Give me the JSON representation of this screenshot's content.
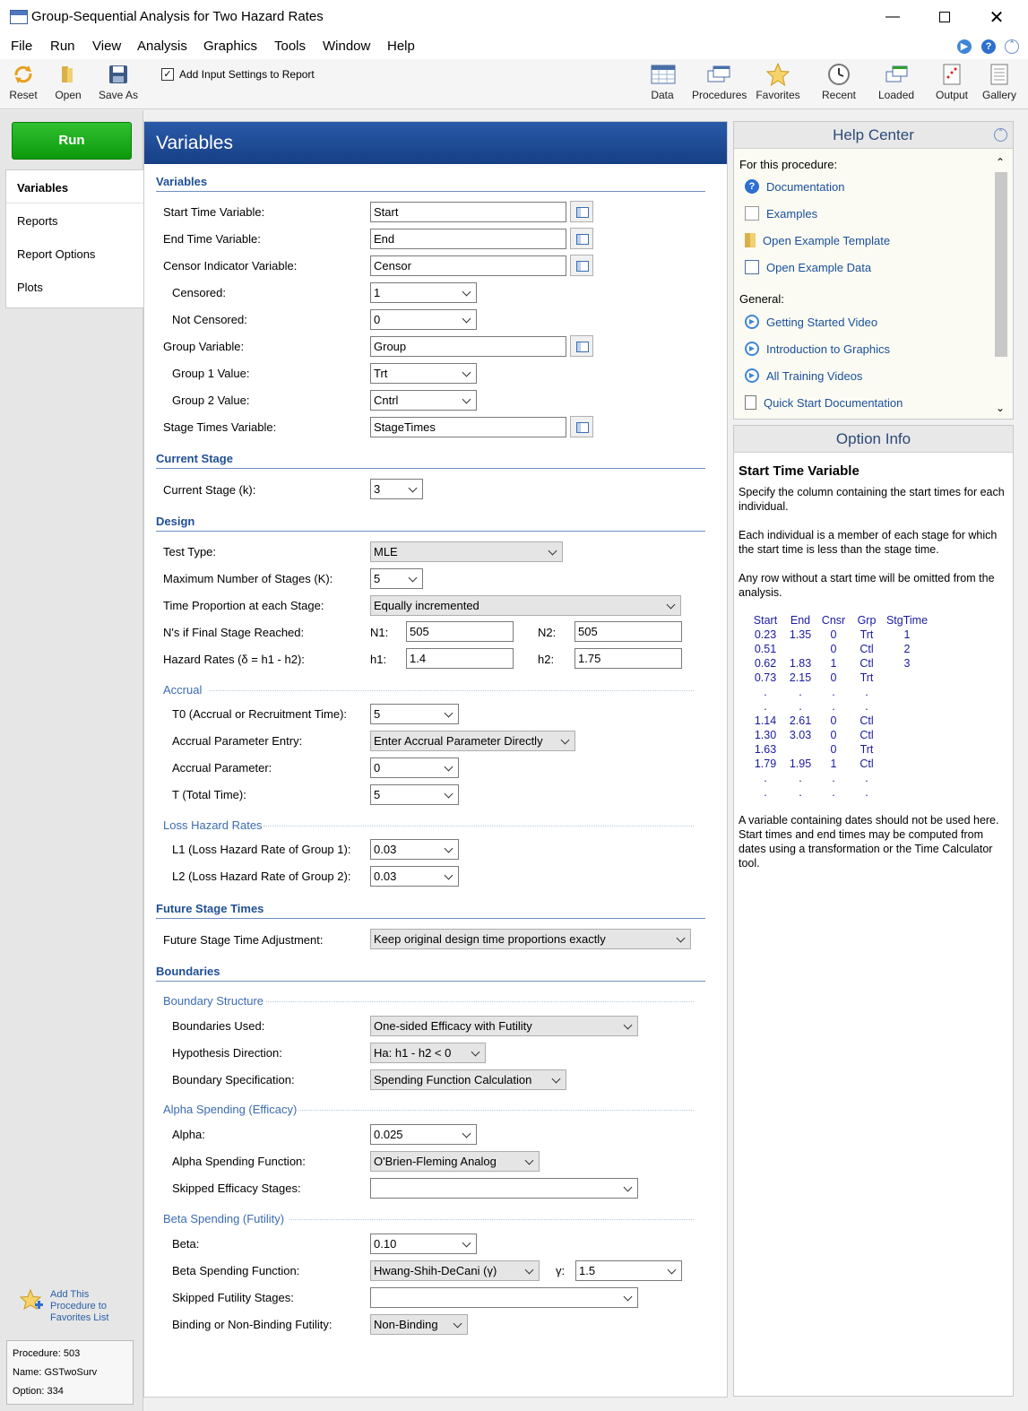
{
  "window": {
    "title": "Group-Sequential Analysis for Two Hazard Rates"
  },
  "menu": [
    "File",
    "Run",
    "View",
    "Analysis",
    "Graphics",
    "Tools",
    "Window",
    "Help"
  ],
  "toolbar": {
    "reset": "Reset",
    "open": "Open",
    "save_as": "Save As",
    "add_input": "Add Input Settings to Report",
    "data": "Data",
    "procedures": "Procedures",
    "favorites": "Favorites",
    "recent": "Recent",
    "loaded": "Loaded",
    "output": "Output",
    "gallery": "Gallery"
  },
  "left": {
    "run": "Run",
    "tabs": [
      "Variables",
      "Reports",
      "Report Options",
      "Plots"
    ],
    "favorites_link": [
      "Add This",
      "Procedure to",
      "Favorites List"
    ],
    "procedure": "Procedure: 503",
    "name": "Name: GSTwoSurv",
    "option": "Option: 334"
  },
  "center": {
    "header": "Variables",
    "variables": {
      "section": "Variables",
      "start_label": "Start Time Variable:",
      "start_value": "Start",
      "end_label": "End Time Variable:",
      "end_value": "End",
      "censor_label": "Censor Indicator Variable:",
      "censor_value": "Censor",
      "censored_label": "Censored:",
      "censored_value": "1",
      "not_censored_label": "Not Censored:",
      "not_censored_value": "0",
      "group_label": "Group Variable:",
      "group_value": "Group",
      "group1_label": "Group 1 Value:",
      "group1_value": "Trt",
      "group2_label": "Group 2 Value:",
      "group2_value": "Cntrl",
      "stage_times_label": "Stage Times Variable:",
      "stage_times_value": "StageTimes"
    },
    "current_stage": {
      "section": "Current Stage",
      "label": "Current Stage (k):",
      "value": "3"
    },
    "design": {
      "section": "Design",
      "test_type_label": "Test Type:",
      "test_type_value": "MLE",
      "max_stages_label": "Maximum Number of Stages (K):",
      "max_stages_value": "5",
      "time_prop_label": "Time Proportion at each Stage:",
      "time_prop_value": "Equally incremented",
      "ns_label": "N's if Final Stage Reached:",
      "n1_label": "N1:",
      "n1_value": "505",
      "n2_label": "N2:",
      "n2_value": "505",
      "hazard_label": "Hazard Rates (δ = h1 - h2):",
      "h1_label": "h1:",
      "h1_value": "1.4",
      "h2_label": "h2:",
      "h2_value": "1.75",
      "accrual_title": "Accrual",
      "t0_label": "T0 (Accrual or Recruitment Time):",
      "t0_value": "5",
      "accrual_entry_label": "Accrual Parameter Entry:",
      "accrual_entry_value": "Enter Accrual Parameter Directly",
      "accrual_param_label": "Accrual Parameter:",
      "accrual_param_value": "0",
      "total_time_label": "T (Total Time):",
      "total_time_value": "5",
      "loss_title": "Loss Hazard Rates",
      "l1_label": "L1 (Loss Hazard Rate of Group 1):",
      "l1_value": "0.03",
      "l2_label": "L2 (Loss Hazard Rate of Group 2):",
      "l2_value": "0.03"
    },
    "future": {
      "section": "Future Stage Times",
      "label": "Future Stage Time Adjustment:",
      "value": "Keep original design time proportions exactly"
    },
    "boundaries": {
      "section": "Boundaries",
      "structure_title": "Boundary Structure",
      "used_label": "Boundaries Used:",
      "used_value": "One-sided Efficacy with Futility",
      "direction_label": "Hypothesis Direction:",
      "direction_value": "Ha: h1 - h2 < 0",
      "spec_label": "Boundary Specification:",
      "spec_value": "Spending Function Calculation",
      "alpha_title": "Alpha Spending (Efficacy)",
      "alpha_label": "Alpha:",
      "alpha_value": "0.025",
      "alpha_fn_label": "Alpha Spending Function:",
      "alpha_fn_value": "O'Brien-Fleming Analog",
      "skip_eff_label": "Skipped Efficacy Stages:",
      "skip_eff_value": "",
      "beta_title": "Beta Spending (Futility)",
      "beta_label": "Beta:",
      "beta_value": "0.10",
      "beta_fn_label": "Beta Spending Function:",
      "beta_fn_value": "Hwang-Shih-DeCani (γ)",
      "gamma_label": "γ:",
      "gamma_value": "1.5",
      "skip_fut_label": "Skipped Futility Stages:",
      "skip_fut_value": "",
      "binding_label": "Binding or Non-Binding Futility:",
      "binding_value": "Non-Binding"
    }
  },
  "help_center": {
    "title": "Help Center",
    "for_proc": "For this procedure:",
    "items": [
      "Documentation",
      "Examples",
      "Open Example Template",
      "Open Example Data"
    ],
    "general": "General:",
    "general_items": [
      "Getting Started Video",
      "Introduction to Graphics",
      "All Training Videos",
      "Quick Start Documentation"
    ]
  },
  "option_info": {
    "title": "Option Info",
    "heading": "Start Time Variable",
    "p1": "Specify the column containing the start times for each individual.",
    "p2": "Each individual is a member of each stage for which the start time is less than the stage time.",
    "p3": "Any row without a start time will be omitted from the analysis.",
    "table_header": [
      "Start",
      "End",
      "Cnsr",
      "Grp",
      "StgTime"
    ],
    "table_rows": [
      [
        "0.23",
        "1.35",
        "0",
        "Trt",
        "1"
      ],
      [
        "0.51",
        "",
        "0",
        "Ctl",
        "2"
      ],
      [
        "0.62",
        "1.83",
        "1",
        "Ctl",
        "3"
      ],
      [
        "0.73",
        "2.15",
        "0",
        "Trt",
        ""
      ],
      [
        ".",
        ".",
        ".",
        ".",
        ""
      ],
      [
        ".",
        ".",
        ".",
        ".",
        ""
      ],
      [
        "1.14",
        "2.61",
        "0",
        "Ctl",
        ""
      ],
      [
        "1.30",
        "3.03",
        "0",
        "Ctl",
        ""
      ],
      [
        "1.63",
        "",
        "0",
        "Trt",
        ""
      ],
      [
        "1.79",
        "1.95",
        "1",
        "Ctl",
        ""
      ],
      [
        ".",
        ".",
        ".",
        ".",
        ""
      ],
      [
        ".",
        ".",
        ".",
        ".",
        ""
      ]
    ],
    "p4": "A variable containing dates should not be used here. Start times and end times may be computed from dates using a transformation or the Time Calculator tool."
  }
}
